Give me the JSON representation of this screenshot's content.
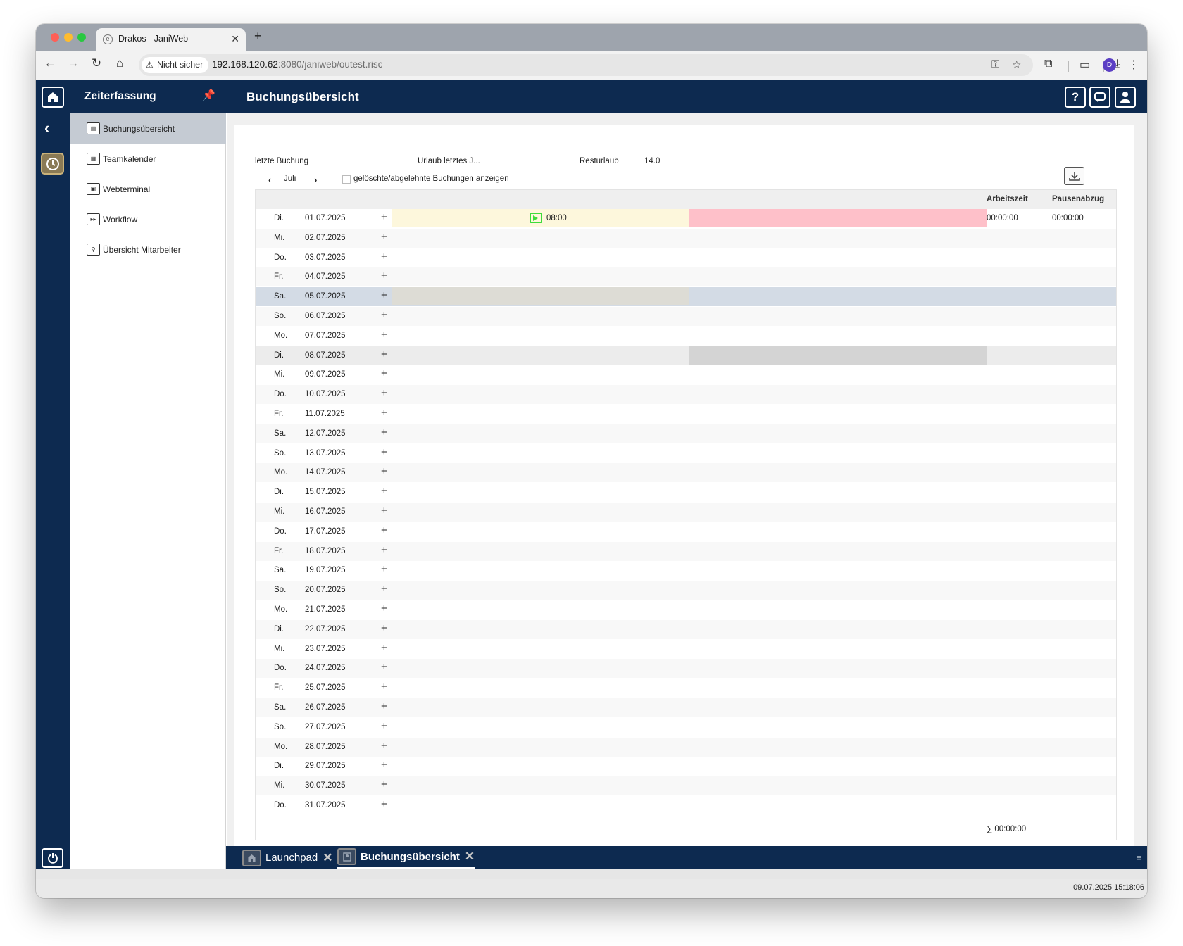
{
  "browser": {
    "tab_title": "Drakos - JaniWeb",
    "security_label": "Nicht sicher",
    "url_host": "192.168.120.62",
    "url_rest": ":8080/janiweb/outest.risc",
    "profile_initial": "D"
  },
  "app": {
    "module_title": "Zeiterfassung",
    "page_title": "Buchungsübersicht",
    "sidebar_items": [
      {
        "label": "Buchungsübersicht",
        "active": true
      },
      {
        "label": "Teamkalender",
        "active": false
      },
      {
        "label": "Webterminal",
        "active": false
      },
      {
        "label": "Workflow",
        "active": false
      },
      {
        "label": "Übersicht Mitarbeiter",
        "active": false
      }
    ]
  },
  "info": {
    "last_booking_label": "letzte Buchung",
    "vacation_label": "Urlaub letztes J...",
    "rest_label": "Resturlaub",
    "rest_value": "14.0",
    "month": "Juli",
    "show_deleted_label": "gelöschte/abgelehnte Buchungen anzeigen"
  },
  "table": {
    "col_work": "Arbeitszeit",
    "col_pause": "Pausenabzug",
    "rows": [
      {
        "day": "Di.",
        "date": "01.07.2025",
        "booking": "08:00",
        "work": "00:00:00",
        "pause": "00:00:00"
      },
      {
        "day": "Mi.",
        "date": "02.07.2025"
      },
      {
        "day": "Do.",
        "date": "03.07.2025"
      },
      {
        "day": "Fr.",
        "date": "04.07.2025"
      },
      {
        "day": "Sa.",
        "date": "05.07.2025"
      },
      {
        "day": "So.",
        "date": "06.07.2025"
      },
      {
        "day": "Mo.",
        "date": "07.07.2025"
      },
      {
        "day": "Di.",
        "date": "08.07.2025"
      },
      {
        "day": "Mi.",
        "date": "09.07.2025"
      },
      {
        "day": "Do.",
        "date": "10.07.2025"
      },
      {
        "day": "Fr.",
        "date": "11.07.2025"
      },
      {
        "day": "Sa.",
        "date": "12.07.2025"
      },
      {
        "day": "So.",
        "date": "13.07.2025"
      },
      {
        "day": "Mo.",
        "date": "14.07.2025"
      },
      {
        "day": "Di.",
        "date": "15.07.2025"
      },
      {
        "day": "Mi.",
        "date": "16.07.2025"
      },
      {
        "day": "Do.",
        "date": "17.07.2025"
      },
      {
        "day": "Fr.",
        "date": "18.07.2025"
      },
      {
        "day": "Sa.",
        "date": "19.07.2025"
      },
      {
        "day": "So.",
        "date": "20.07.2025"
      },
      {
        "day": "Mo.",
        "date": "21.07.2025"
      },
      {
        "day": "Di.",
        "date": "22.07.2025"
      },
      {
        "day": "Mi.",
        "date": "23.07.2025"
      },
      {
        "day": "Do.",
        "date": "24.07.2025"
      },
      {
        "day": "Fr.",
        "date": "25.07.2025"
      },
      {
        "day": "Sa.",
        "date": "26.07.2025"
      },
      {
        "day": "So.",
        "date": "27.07.2025"
      },
      {
        "day": "Mo.",
        "date": "28.07.2025"
      },
      {
        "day": "Di.",
        "date": "29.07.2025"
      },
      {
        "day": "Mi.",
        "date": "30.07.2025"
      },
      {
        "day": "Do.",
        "date": "31.07.2025"
      }
    ],
    "sum_label": "∑ 00:00:00"
  },
  "bottom_tabs": [
    {
      "label": "Launchpad",
      "active": false
    },
    {
      "label": "Buchungsübersicht",
      "active": true
    }
  ],
  "status_clock": "09.07.2025 15:18:06",
  "icons": {
    "home": "home-icon",
    "pin": "pin-icon",
    "help": "help-icon",
    "chat": "chat-icon",
    "user": "user-icon",
    "back": "chevron-left-icon",
    "clock": "clock-icon",
    "power": "power-icon",
    "export": "export-icon"
  },
  "colors": {
    "navy": "#0d2a50",
    "booking_green": "#3ddc3a",
    "today_yellow": "#fdf7dc",
    "today_red": "#fec0c9",
    "weekend_blue": "#d3dbe5"
  }
}
